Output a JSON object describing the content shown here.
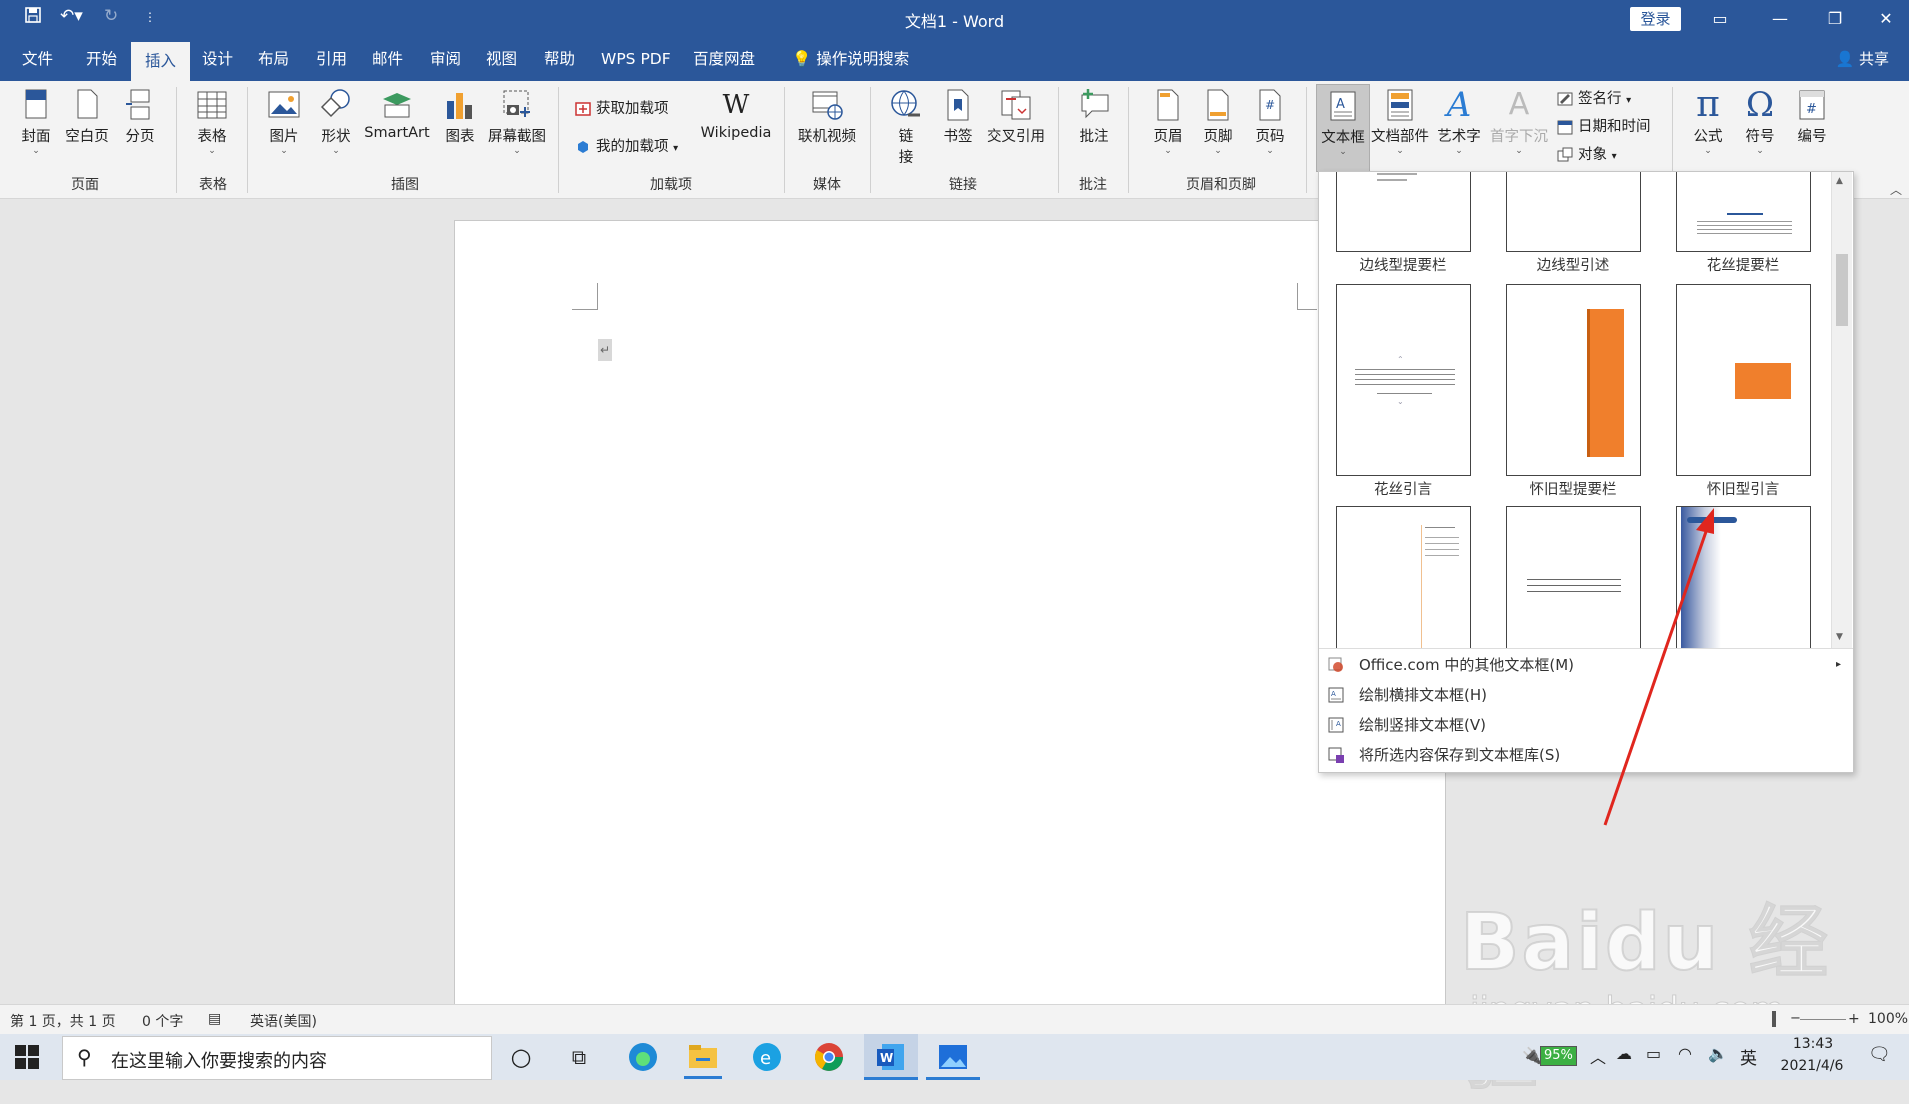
{
  "titlebar": {
    "title": "文档1  -  Word",
    "login": "登录",
    "qat": {
      "save": "save-icon",
      "undo": "undo-icon",
      "redo": "redo-icon",
      "customize": "customize-icon"
    }
  },
  "tabs": [
    "文件",
    "开始",
    "插入",
    "设计",
    "布局",
    "引用",
    "邮件",
    "审阅",
    "视图",
    "帮助",
    "WPS PDF",
    "百度网盘",
    "操作说明搜索"
  ],
  "active_tab": "插入",
  "share": "共享",
  "ribbon": {
    "page_group": {
      "cover": "封面",
      "blank": "空白页",
      "break": "分页",
      "label": "页面"
    },
    "table_group": {
      "table": "表格",
      "label": "表格"
    },
    "illustrations": {
      "picture": "图片",
      "shapes": "形状",
      "smartart": "SmartArt",
      "chart": "图表",
      "screenshot": "屏幕截图",
      "label": "插图"
    },
    "addins": {
      "get": "获取加载项",
      "mine": "我的加载项",
      "wikipedia": "Wikipedia",
      "label": "加载项"
    },
    "media": {
      "video": "联机视频",
      "label": "媒体"
    },
    "links": {
      "link_1": "链",
      "link_2": "接",
      "bookmark": "书签",
      "crossref": "交叉引用",
      "label": "链接"
    },
    "comments": {
      "comment": "批注",
      "label": "批注"
    },
    "header_footer": {
      "header": "页眉",
      "footer": "页脚",
      "pagenum": "页码",
      "label": "页眉和页脚"
    },
    "text": {
      "textbox": "文本框",
      "parts": "文档部件",
      "wordart": "艺术字",
      "dropcap": "首字下沉",
      "signature": "签名行",
      "datetime": "日期和时间",
      "object": "对象"
    },
    "symbols": {
      "equation": "公式",
      "symbol": "符号",
      "number": "编号"
    }
  },
  "gallery": {
    "labels": [
      "边线型提要栏",
      "边线型引述",
      "花丝提要栏",
      "花丝引言",
      "怀旧型提要栏",
      "怀旧型引言"
    ],
    "menu": [
      {
        "text": "Office.com 中的其他文本框(M)",
        "icon": "office-icon"
      },
      {
        "text": "绘制横排文本框(H)",
        "icon": "horizontal-textbox-icon"
      },
      {
        "text": "绘制竖排文本框(V)",
        "icon": "vertical-textbox-icon"
      },
      {
        "text": "将所选内容保存到文本框库(S)",
        "icon": "save-gallery-icon"
      }
    ]
  },
  "status": {
    "page": "第 1 页，共 1 页",
    "words": "0 个字",
    "lang": "英语(美国)",
    "zoom": "100%"
  },
  "taskbar": {
    "search_placeholder": "在这里输入你要搜索的内容",
    "battery": "95%",
    "ime": "英",
    "time": "13:43",
    "date": "2021/4/6"
  },
  "watermark": {
    "line1": "Baidu 经验",
    "line2": "jingyan.baidu.com"
  },
  "colors": {
    "brand": "#2b579a",
    "accent_orange": "#f07f2c",
    "arrow": "#e0261e"
  }
}
